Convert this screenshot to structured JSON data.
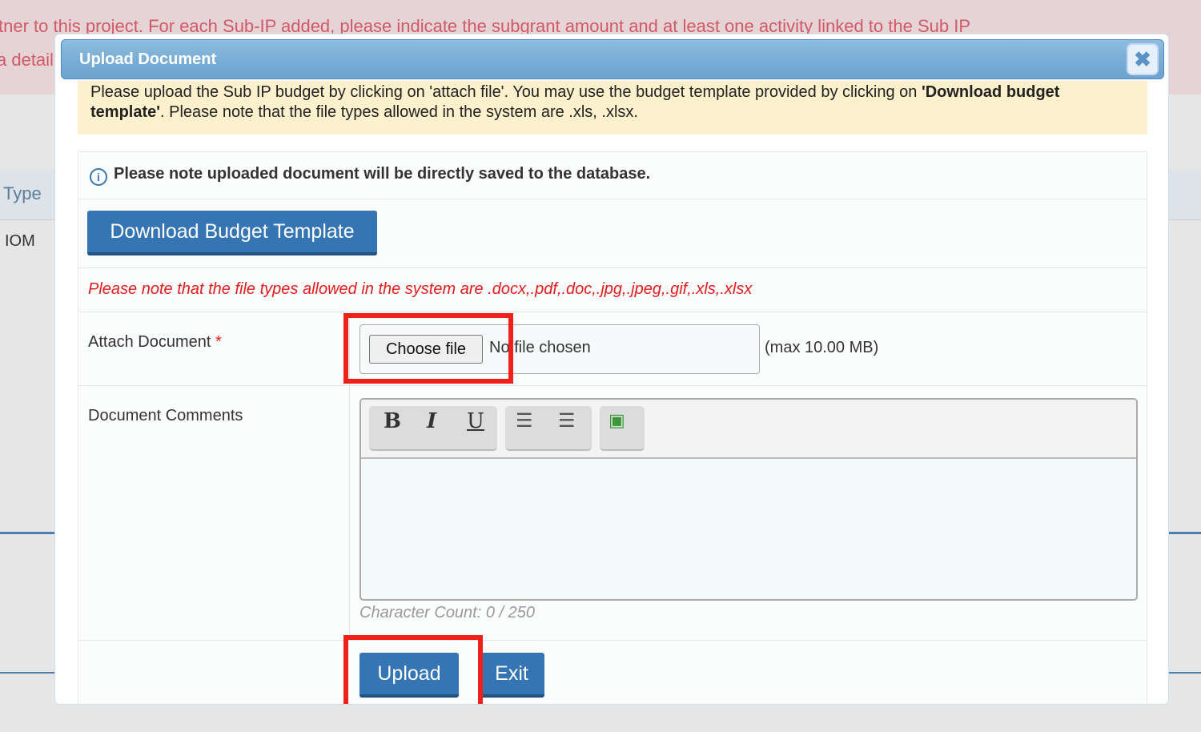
{
  "background": {
    "line1": "tner to this project. For each Sub-IP added, please indicate the subgrant amount and at least one activity linked to the Sub IP",
    "line2": "a detail",
    "col_type": "Type",
    "cell_iom": "IOM"
  },
  "modal": {
    "title": "Upload Document",
    "close_icon": "close-x-icon",
    "notice_text": "Please upload the Sub IP budget by clicking on 'attach file'. You may use the budget template provided by clicking on ",
    "notice_bold1": "'Download budget template'",
    "notice_text2": ". Please note that the file types allowed in the system are .xls, .xlsx.",
    "info": "Please note uploaded document will be directly saved to the database.",
    "download_label": "Download Budget Template",
    "file_types_note": "Please note that the file types allowed in the system are .docx,.pdf,.doc,.jpg,.jpeg,.gif,.xls,.xlsx",
    "attach_label": "Attach Document",
    "required": "*",
    "choose_file": "Choose file",
    "no_file": "No file chosen",
    "max_size": "(max 10.00 MB)",
    "comments_label": "Document Comments",
    "toolbar": {
      "bold": "B",
      "italic": "I",
      "underline": "U"
    },
    "char_count": "Character Count: 0 / 250",
    "upload_label": "Upload",
    "exit_label": "Exit"
  },
  "colors": {
    "highlight": "#f0211b",
    "primary": "#3675b4",
    "notice_bg": "#fdf0cd"
  }
}
